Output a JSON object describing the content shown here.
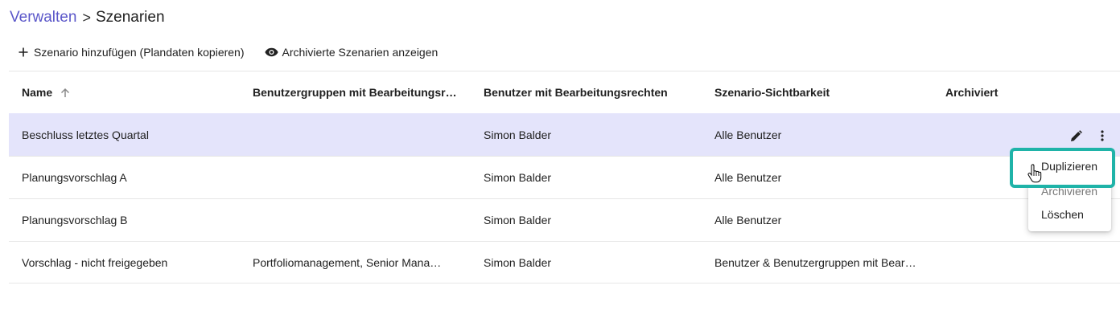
{
  "breadcrumb": {
    "parent": "Verwalten",
    "separator": ">",
    "current": "Szenarien"
  },
  "toolbar": {
    "add_label": "Szenario hinzufügen (Plandaten kopieren)",
    "add_icon": "plus-icon",
    "show_archived_label": "Archivierte Szenarien anzeigen",
    "show_archived_icon": "eye-icon"
  },
  "table": {
    "columns": [
      "Name",
      "Benutzergruppen mit Bearbeitungsr…",
      "Benutzer mit Bearbeitungsrechten",
      "Szenario-Sichtbarkeit",
      "Archiviert"
    ],
    "sort": {
      "column": "Name",
      "direction": "ascending",
      "icon": "arrow-up-icon"
    },
    "rows": [
      {
        "name": "Beschluss letztes Quartal",
        "groups": "",
        "users": "Simon Balder",
        "visibility": "Alle Benutzer",
        "archived": "",
        "selected": true
      },
      {
        "name": "Planungsvorschlag A",
        "groups": "",
        "users": "Simon Balder",
        "visibility": "Alle Benutzer",
        "archived": ""
      },
      {
        "name": "Planungsvorschlag B",
        "groups": "",
        "users": "Simon Balder",
        "visibility": "Alle Benutzer",
        "archived": ""
      },
      {
        "name": "Vorschlag - nicht freigegeben",
        "groups": "Portfoliomanagement, Senior Manage…",
        "users": "Simon Balder",
        "visibility": "Benutzer & Benutzergruppen mit Bearb…",
        "archived": ""
      }
    ]
  },
  "row_actions": {
    "edit_icon": "pencil-icon",
    "more_icon": "more-vertical-icon"
  },
  "context_menu": {
    "items": [
      "Duplizieren",
      "Archivieren",
      "Löschen"
    ],
    "highlighted": "Duplizieren"
  },
  "colors": {
    "accent": "#5b57c9",
    "selected_row": "#e4e4fb",
    "highlight_border": "#1fb3a8"
  }
}
